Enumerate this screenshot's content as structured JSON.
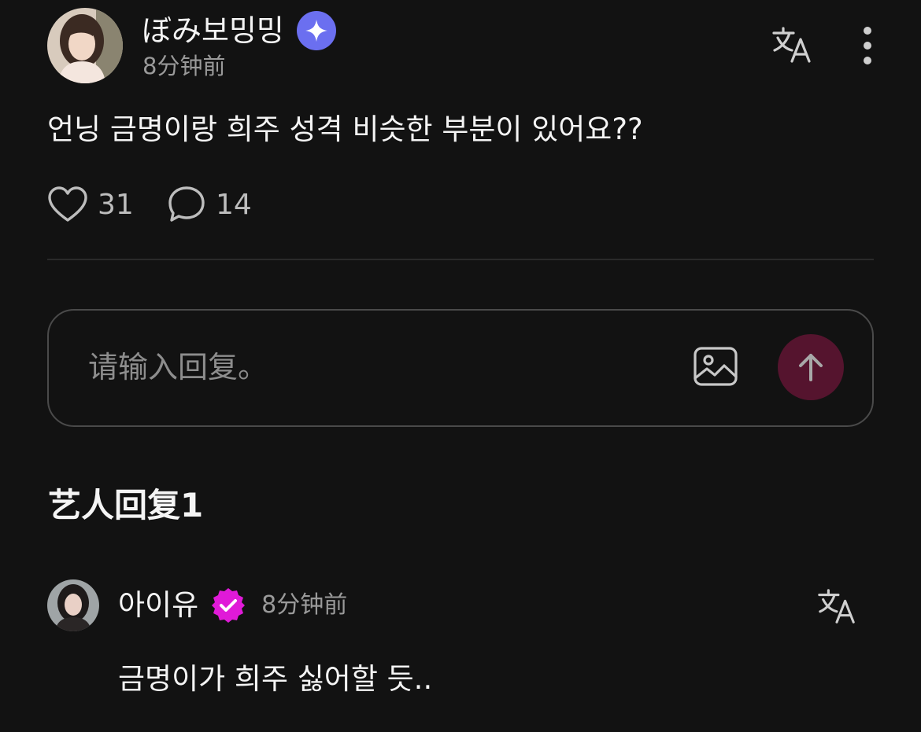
{
  "post": {
    "username": "ぼみ보밍밍",
    "time": "8分钟前",
    "content": "언닝 금명이랑 희주 성격 비슷한 부분이 있어요??",
    "like_count": "31",
    "comment_count": "14"
  },
  "reply_box": {
    "placeholder": "请输入回复。"
  },
  "artist_replies": {
    "title": "艺人回复1",
    "items": [
      {
        "name": "아이유",
        "time": "8分钟前",
        "content": "금명이가 희주 싫어할 듯.."
      }
    ]
  },
  "icons": {
    "author_badge": "sparkle-star-icon",
    "artist_badge": "verified-check-icon",
    "translate": "translate-icon",
    "more": "more-vertical-icon",
    "like": "heart-outline-icon",
    "comment": "speech-bubble-icon",
    "image": "image-icon",
    "send": "arrow-up-icon"
  },
  "colors": {
    "background": "#121212",
    "author_badge": "#6b6ff0",
    "artist_badge": "#e01ad8",
    "send_button": "#55142e",
    "secondary_text": "#9a9a9a"
  }
}
